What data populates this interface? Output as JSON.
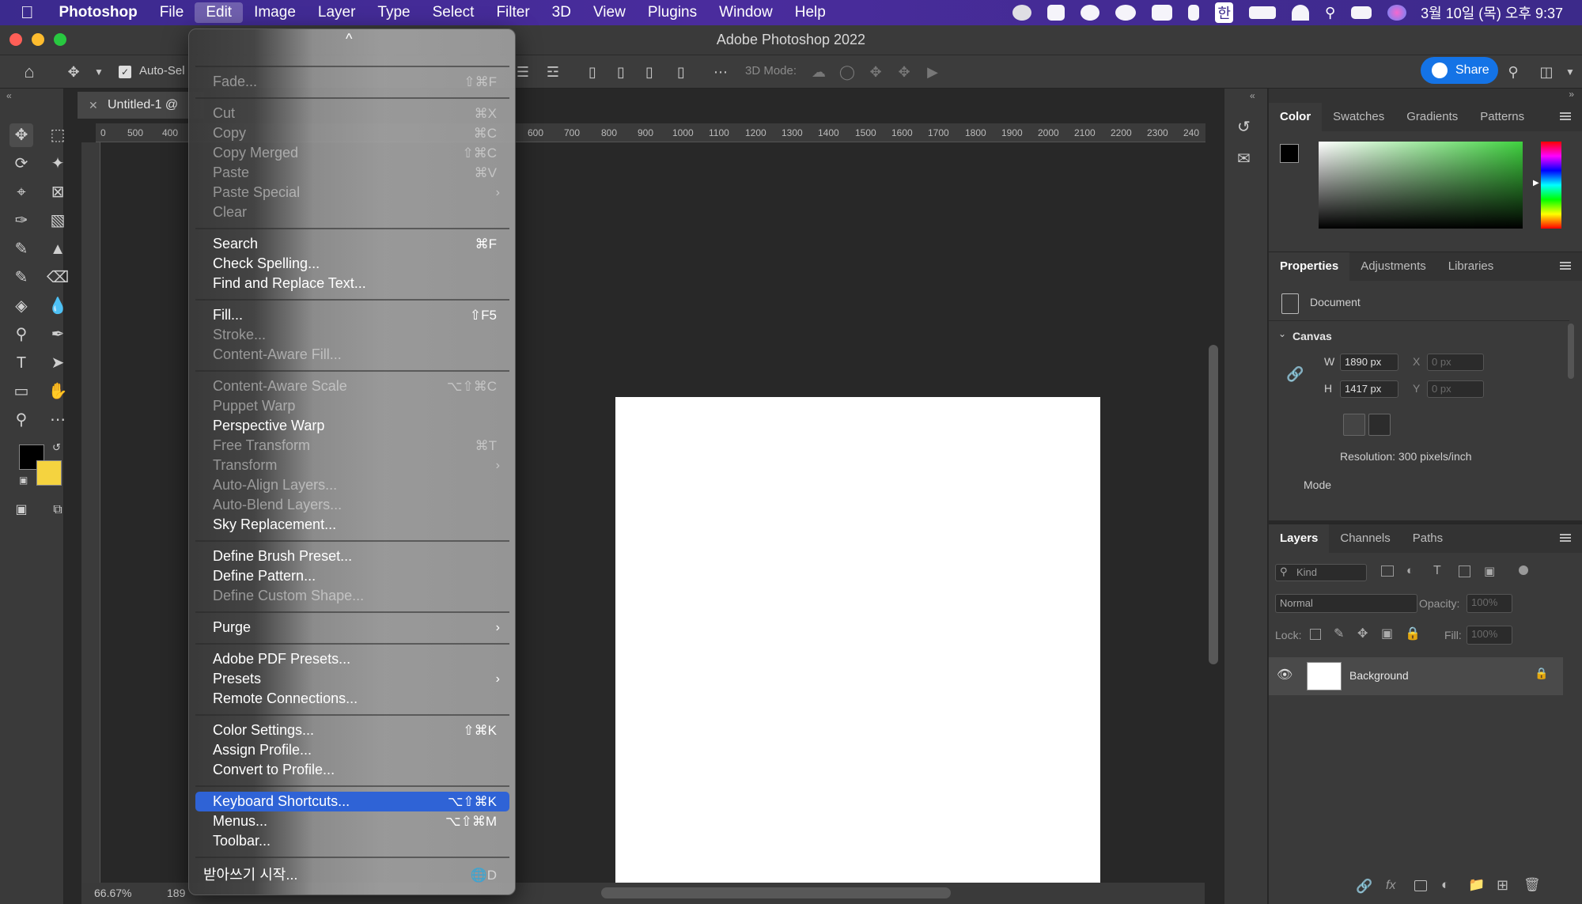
{
  "menubar": {
    "app": "Photoshop",
    "items": [
      "File",
      "Edit",
      "Image",
      "Layer",
      "Type",
      "Select",
      "Filter",
      "3D",
      "View",
      "Plugins",
      "Window",
      "Help"
    ],
    "active": "Edit",
    "clock": "3월 10일 (목) 오후 9:37",
    "input_source": "한"
  },
  "window": {
    "title": "Adobe Photoshop 2022"
  },
  "options_bar": {
    "auto_select_label": "Auto-Sel",
    "mode_label": "3D Mode:",
    "share_label": "Share"
  },
  "document": {
    "tab_label": "Untitled-1 @",
    "zoom": "66.67%",
    "status_partial": "189",
    "ruler_ticks": [
      "0",
      "500",
      "400",
      "600",
      "700",
      "800",
      "900",
      "1000",
      "1100",
      "1200",
      "1300",
      "1400",
      "1500",
      "1600",
      "1700",
      "1800",
      "1900",
      "2000",
      "2100",
      "2200",
      "2300",
      "240"
    ]
  },
  "edit_menu": {
    "top_chevron": "^",
    "items": [
      {
        "label": "Fade...",
        "shortcut": "⇧⌘F",
        "enabled": false
      },
      {
        "label": "Cut",
        "shortcut": "⌘X",
        "enabled": false
      },
      {
        "label": "Copy",
        "shortcut": "⌘C",
        "enabled": false
      },
      {
        "label": "Copy Merged",
        "shortcut": "⇧⌘C",
        "enabled": false
      },
      {
        "label": "Paste",
        "shortcut": "⌘V",
        "enabled": false
      },
      {
        "label": "Paste Special",
        "shortcut": "›",
        "enabled": false
      },
      {
        "label": "Clear",
        "shortcut": "",
        "enabled": false
      },
      {
        "label": "Search",
        "shortcut": "⌘F",
        "enabled": true
      },
      {
        "label": "Check Spelling...",
        "shortcut": "",
        "enabled": true
      },
      {
        "label": "Find and Replace Text...",
        "shortcut": "",
        "enabled": true
      },
      {
        "label": "Fill...",
        "shortcut": "⇧F5",
        "enabled": true
      },
      {
        "label": "Stroke...",
        "shortcut": "",
        "enabled": false
      },
      {
        "label": "Content-Aware Fill...",
        "shortcut": "",
        "enabled": false
      },
      {
        "label": "Content-Aware Scale",
        "shortcut": "⌥⇧⌘C",
        "enabled": false
      },
      {
        "label": "Puppet Warp",
        "shortcut": "",
        "enabled": false
      },
      {
        "label": "Perspective Warp",
        "shortcut": "",
        "enabled": true
      },
      {
        "label": "Free Transform",
        "shortcut": "⌘T",
        "enabled": false
      },
      {
        "label": "Transform",
        "shortcut": "›",
        "enabled": false
      },
      {
        "label": "Auto-Align Layers...",
        "shortcut": "",
        "enabled": false
      },
      {
        "label": "Auto-Blend Layers...",
        "shortcut": "",
        "enabled": false
      },
      {
        "label": "Sky Replacement...",
        "shortcut": "",
        "enabled": true
      },
      {
        "label": "Define Brush Preset...",
        "shortcut": "",
        "enabled": true
      },
      {
        "label": "Define Pattern...",
        "shortcut": "",
        "enabled": true
      },
      {
        "label": "Define Custom Shape...",
        "shortcut": "",
        "enabled": false
      },
      {
        "label": "Purge",
        "shortcut": "›",
        "enabled": true
      },
      {
        "label": "Adobe PDF Presets...",
        "shortcut": "",
        "enabled": true
      },
      {
        "label": "Presets",
        "shortcut": "›",
        "enabled": true
      },
      {
        "label": "Remote Connections...",
        "shortcut": "",
        "enabled": true
      },
      {
        "label": "Color Settings...",
        "shortcut": "⇧⌘K",
        "enabled": true
      },
      {
        "label": "Assign Profile...",
        "shortcut": "",
        "enabled": true
      },
      {
        "label": "Convert to Profile...",
        "shortcut": "",
        "enabled": true
      },
      {
        "label": "Keyboard Shortcuts...",
        "shortcut": "⌥⇧⌘K",
        "enabled": true,
        "highlighted": true
      },
      {
        "label": "Menus...",
        "shortcut": "⌥⇧⌘M",
        "enabled": true
      },
      {
        "label": "Toolbar...",
        "shortcut": "",
        "enabled": true
      },
      {
        "label": "받아쓰기 시작...",
        "shortcut": "🌐D",
        "enabled": true
      }
    ]
  },
  "color_panel": {
    "tabs": [
      "Color",
      "Swatches",
      "Gradients",
      "Patterns"
    ],
    "active": "Color",
    "foreground": "#000000",
    "background": "#f5d33f"
  },
  "properties_panel": {
    "tabs": [
      "Properties",
      "Adjustments",
      "Libraries"
    ],
    "active": "Properties",
    "doc_label": "Document",
    "section": "Canvas",
    "w_label": "W",
    "w_value": "1890 px",
    "h_label": "H",
    "h_value": "1417 px",
    "x_label": "X",
    "x_placeholder": "0 px",
    "y_label": "Y",
    "y_placeholder": "0 px",
    "resolution": "Resolution: 300 pixels/inch",
    "mode_label": "Mode"
  },
  "layers_panel": {
    "tabs": [
      "Layers",
      "Channels",
      "Paths"
    ],
    "active": "Layers",
    "kind_placeholder": "Kind",
    "blend_mode": "Normal",
    "opacity_label": "Opacity:",
    "opacity_value": "100%",
    "lock_label": "Lock:",
    "fill_label": "Fill:",
    "fill_value": "100%",
    "layers": [
      {
        "name": "Background",
        "visible": true,
        "locked": true
      }
    ]
  }
}
